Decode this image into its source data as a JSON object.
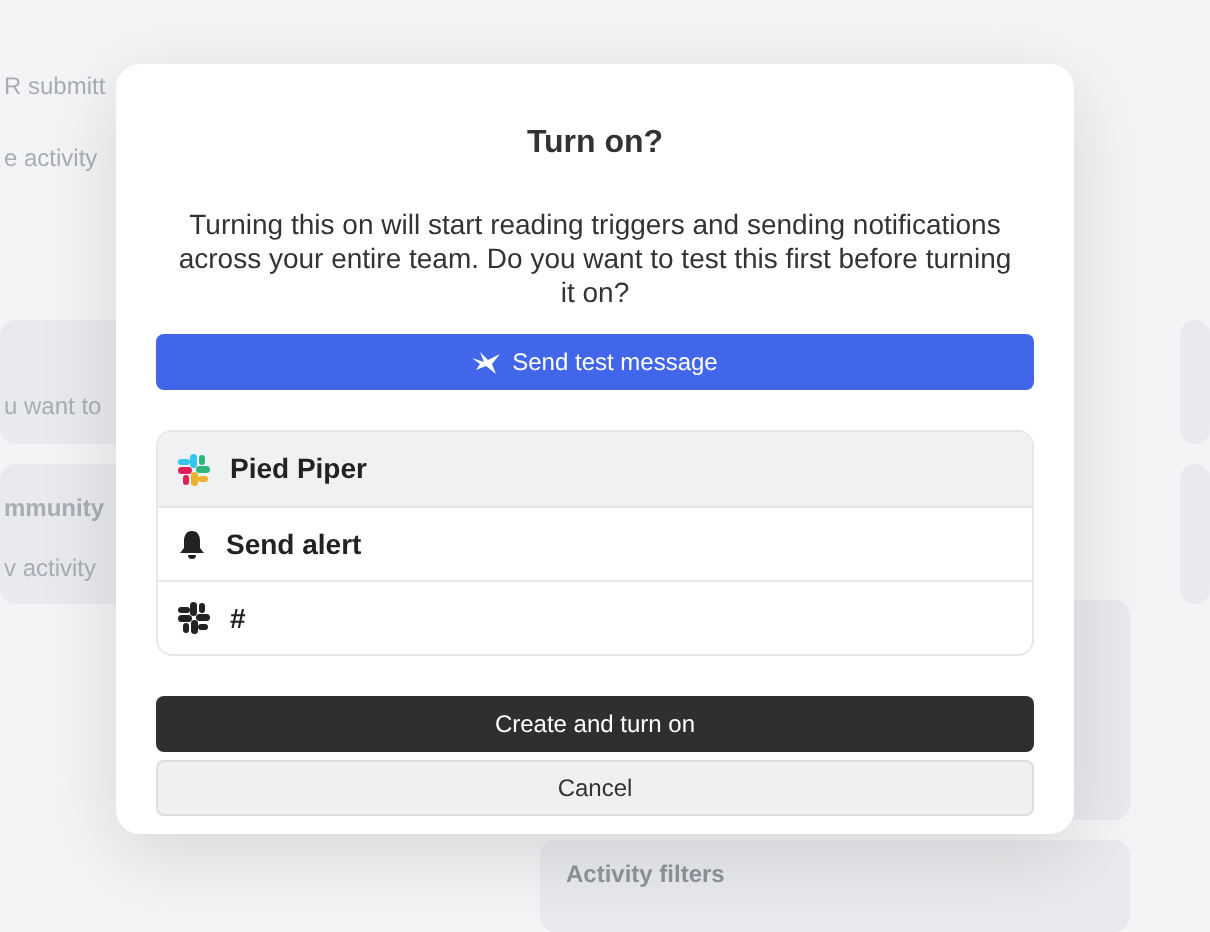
{
  "background": {
    "texts": [
      {
        "kind": "row",
        "label": "R submitt"
      },
      {
        "kind": "row",
        "label": "e activity"
      },
      {
        "kind": "card",
        "label": "u want to"
      },
      {
        "kind": "card-title",
        "label": "mmunity"
      },
      {
        "kind": "card",
        "label": "v activity"
      }
    ],
    "panel_title": "Activity filters"
  },
  "dialog": {
    "title": "Turn on?",
    "message": "Turning this on will start reading triggers and sending notifications across your entire team. Do you want to test this first before turning it on?",
    "test_button": "Send test message",
    "items": [
      {
        "kind": "workspace",
        "label": "Pied Piper"
      },
      {
        "kind": "alert",
        "label": "Send alert"
      },
      {
        "kind": "channel",
        "label": "#"
      }
    ],
    "primary_button": "Create and turn on",
    "cancel_button": "Cancel"
  }
}
